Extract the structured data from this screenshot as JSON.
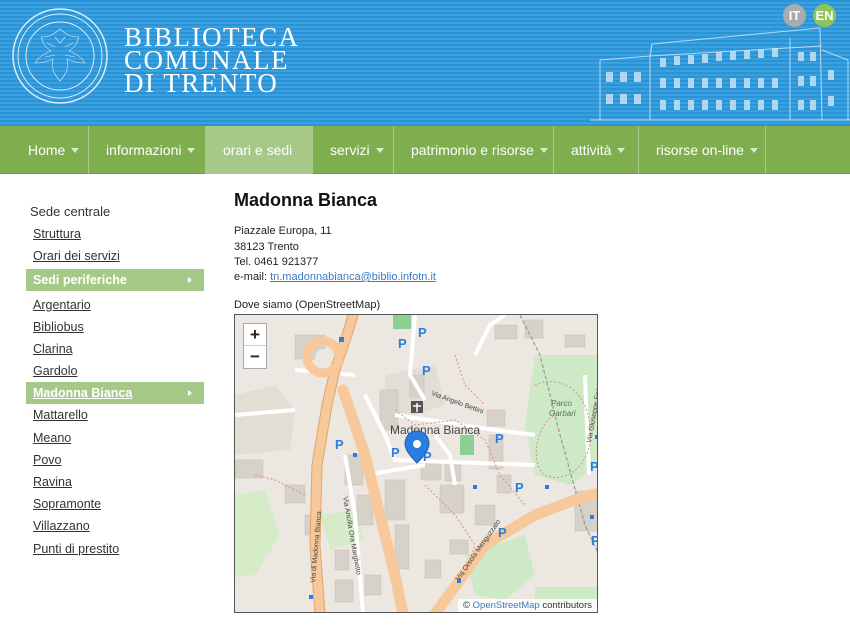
{
  "header": {
    "title_lines": [
      "BIBLIOTECA",
      "COMUNALE",
      "DI TRENTO"
    ],
    "lang_it": "IT",
    "lang_en": "EN"
  },
  "nav": {
    "items": [
      {
        "label": "Home",
        "caret": true
      },
      {
        "label": "informazioni",
        "caret": true
      },
      {
        "label": "orari e sedi",
        "caret": false,
        "active": true
      },
      {
        "label": "servizi",
        "caret": true
      },
      {
        "label": "patrimonio e risorse",
        "caret": true
      },
      {
        "label": "attività",
        "caret": true
      },
      {
        "label": "risorse on-line",
        "caret": true
      }
    ]
  },
  "sidebar": {
    "heading": "Sede centrale",
    "top_links": [
      "Struttura",
      "Orari dei servizi"
    ],
    "section_label": "Sedi periferiche",
    "links": [
      "Argentario",
      "Bibliobus",
      "Clarina",
      "Gardolo",
      "Madonna Bianca",
      "Mattarello",
      "Meano",
      "Povo",
      "Ravina",
      "Sopramonte",
      "Villazzano",
      "Punti di prestito"
    ],
    "active_link": "Madonna Bianca"
  },
  "content": {
    "title": "Madonna Bianca",
    "address": "Piazzale Europa, 11",
    "city": "38123 Trento",
    "phone": "Tel. 0461 921377",
    "email_label": "e-mail:",
    "email": "tn.madonnabianca@biblio.infotn.it",
    "map_heading": "Dove siamo (OpenStreetMap)"
  },
  "map": {
    "zoom_in": "+",
    "zoom_out": "−",
    "place_label": "Madonna Bianca",
    "park_label_1": "Parco",
    "park_label_2": "Garbari",
    "streets": [
      "Via Angelo Bettini",
      "Via Giuseppe Ferrari",
      "Via Orsola Menguzzato",
      "Via di Madonna Bianca",
      "Via Ancilla Ora Marghetto"
    ],
    "attribution_prefix": "©",
    "attribution_link": "OpenStreetMap",
    "attribution_suffix": "contributors"
  }
}
